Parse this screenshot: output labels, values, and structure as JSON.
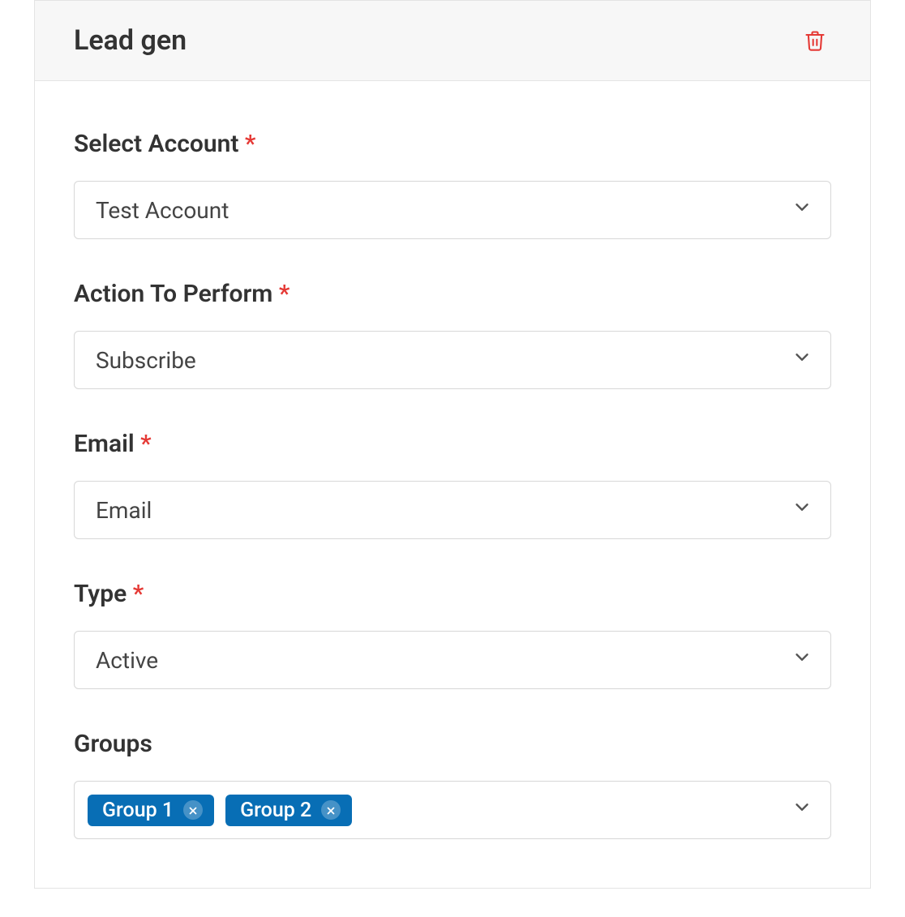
{
  "header": {
    "title": "Lead gen"
  },
  "fields": {
    "account": {
      "label": "Select Account",
      "required": true,
      "value": "Test Account"
    },
    "action": {
      "label": "Action To Perform",
      "required": true,
      "value": "Subscribe"
    },
    "email": {
      "label": "Email",
      "required": true,
      "value": "Email"
    },
    "type": {
      "label": "Type",
      "required": true,
      "value": "Active"
    },
    "groups": {
      "label": "Groups",
      "required": false,
      "tags": [
        "Group 1",
        "Group 2"
      ]
    }
  },
  "required_mark": "*"
}
